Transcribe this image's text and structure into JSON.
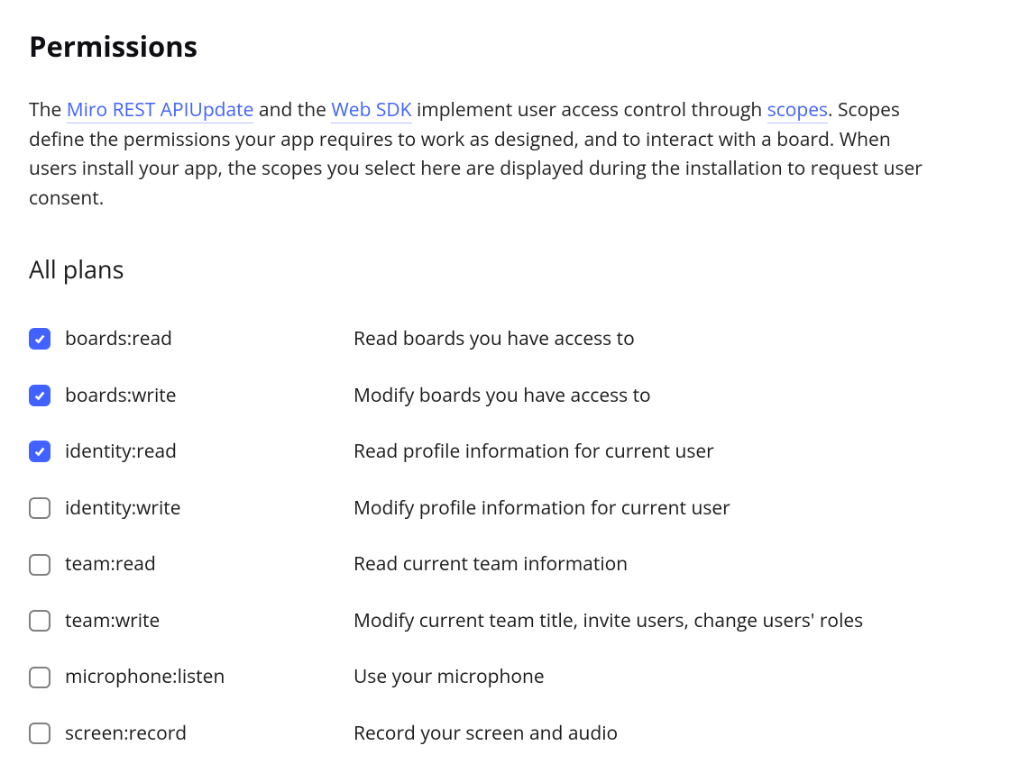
{
  "title": "Permissions",
  "intro": {
    "prefix": "The ",
    "link1": "Miro REST APIUpdate",
    "mid1": " and the ",
    "link2": "Web SDK",
    "mid2": " implement user access control through ",
    "link3": "scopes",
    "suffix": ". Scopes define the permissions your app requires to work as designed, and to interact with a board. When users install your app, the scopes you select here are displayed during the installation to request user consent."
  },
  "section_heading": "All plans",
  "permissions": [
    {
      "name": "boards:read",
      "desc": "Read boards you have access to",
      "checked": true
    },
    {
      "name": "boards:write",
      "desc": "Modify boards you have access to",
      "checked": true
    },
    {
      "name": "identity:read",
      "desc": "Read profile information for current user",
      "checked": true
    },
    {
      "name": "identity:write",
      "desc": "Modify profile information for current user",
      "checked": false
    },
    {
      "name": "team:read",
      "desc": "Read current team information",
      "checked": false
    },
    {
      "name": "team:write",
      "desc": "Modify current team title, invite users, change users' roles",
      "checked": false
    },
    {
      "name": "microphone:listen",
      "desc": "Use your microphone",
      "checked": false
    },
    {
      "name": "screen:record",
      "desc": "Record your screen and audio",
      "checked": false
    }
  ]
}
